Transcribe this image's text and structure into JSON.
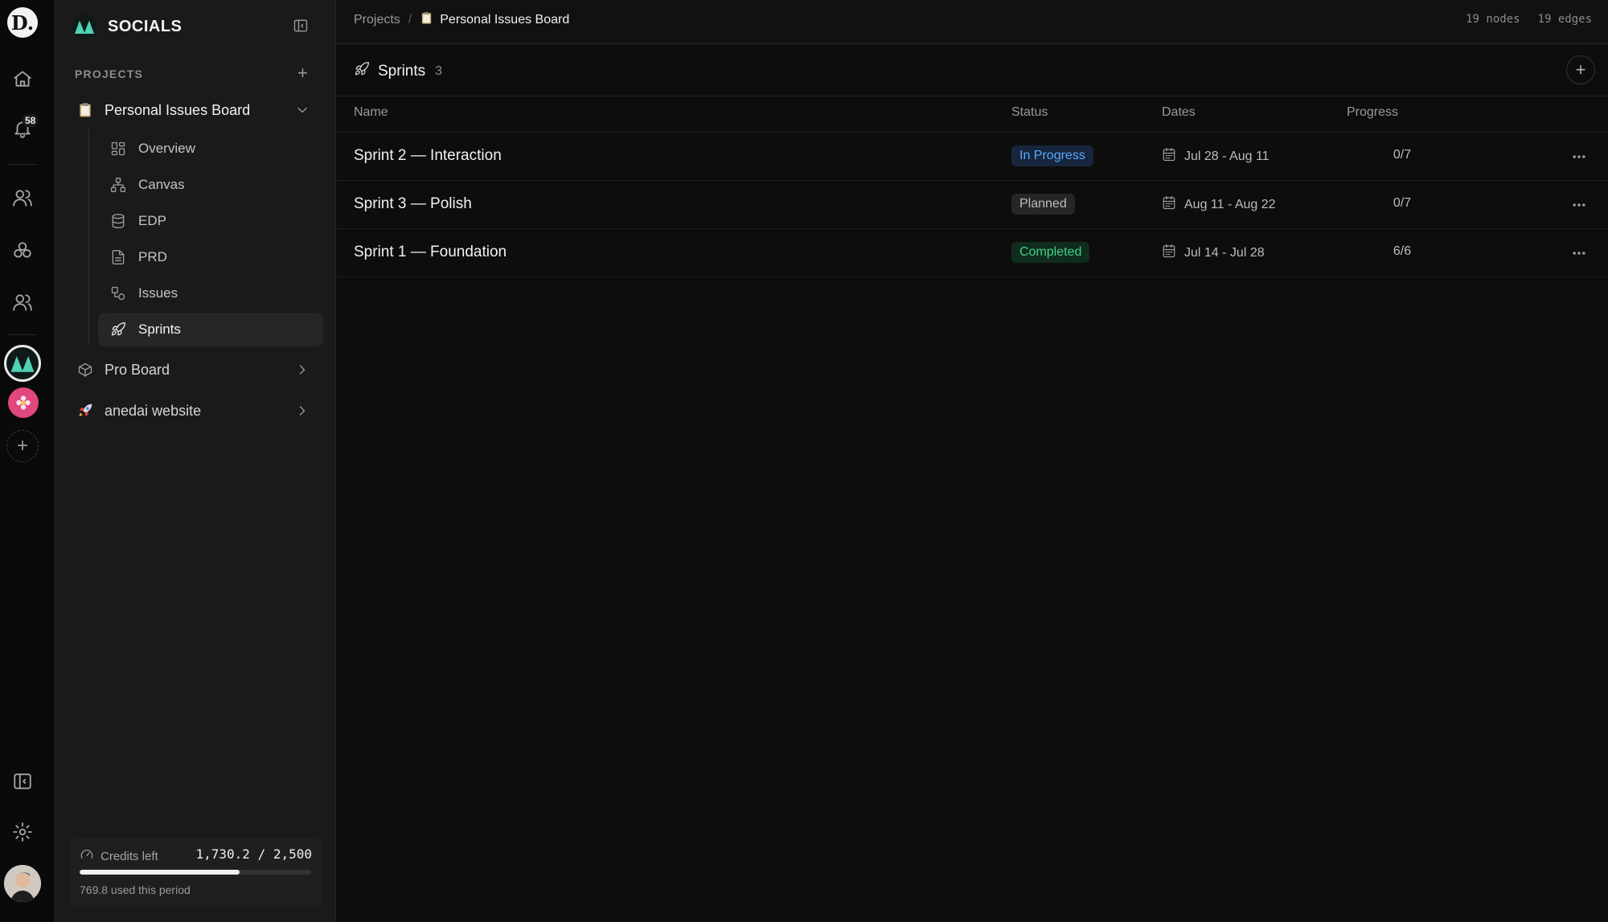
{
  "rail": {
    "logo_letter": "D.",
    "notification_count": "58",
    "items": [
      "home-icon",
      "bell-icon",
      "people-icon",
      "apps-icon",
      "team-icon"
    ],
    "workspaces": [
      "socials-logo",
      "flower-logo"
    ],
    "bottom": [
      "panel-icon",
      "gear-icon"
    ]
  },
  "sidebar": {
    "workspace_name": "SOCIALS",
    "projects_label": "PROJECTS",
    "projects": [
      {
        "label": "Personal Issues Board",
        "icon": "clipboard-emoji",
        "open": true
      },
      {
        "label": "Pro Board",
        "icon": "box-icon",
        "open": false
      },
      {
        "label": "anedai website",
        "icon": "rocket-emoji",
        "open": false
      }
    ],
    "sub_items": [
      {
        "label": "Overview",
        "icon": "grid-icon"
      },
      {
        "label": "Canvas",
        "icon": "hierarchy-icon"
      },
      {
        "label": "EDP",
        "icon": "database-icon"
      },
      {
        "label": "PRD",
        "icon": "document-icon"
      },
      {
        "label": "Issues",
        "icon": "issues-icon"
      },
      {
        "label": "Sprints",
        "icon": "rocket-icon",
        "active": true
      }
    ],
    "credits": {
      "label": "Credits left",
      "value": "1,730.2 / 2,500",
      "used_text": "769.8 used this period",
      "fraction_left": 0.692
    }
  },
  "topbar": {
    "crumb_root": "Projects",
    "crumb_separator": "/",
    "crumb_current": "Personal Issues Board",
    "nodes": "19 nodes",
    "edges": "19 edges"
  },
  "list": {
    "title": "Sprints",
    "count": "3",
    "columns": {
      "name": "Name",
      "status": "Status",
      "dates": "Dates",
      "progress": "Progress"
    },
    "rows": [
      {
        "name": "Sprint 2 — Interaction",
        "status": "In Progress",
        "status_kind": "inprogress",
        "dates": "Jul 28 - Aug 11",
        "progress": "0/7"
      },
      {
        "name": "Sprint 3 — Polish",
        "status": "Planned",
        "status_kind": "planned",
        "dates": "Aug 11 - Aug 22",
        "progress": "0/7"
      },
      {
        "name": "Sprint 1 — Foundation",
        "status": "Completed",
        "status_kind": "completed",
        "dates": "Jul 14 - Jul 28",
        "progress": "6/6"
      }
    ]
  },
  "colors": {
    "in_progress": "#5aa8ff",
    "completed": "#3fd38a",
    "workspace_teal": "#4fd1b5",
    "pink": "#e2477f"
  }
}
